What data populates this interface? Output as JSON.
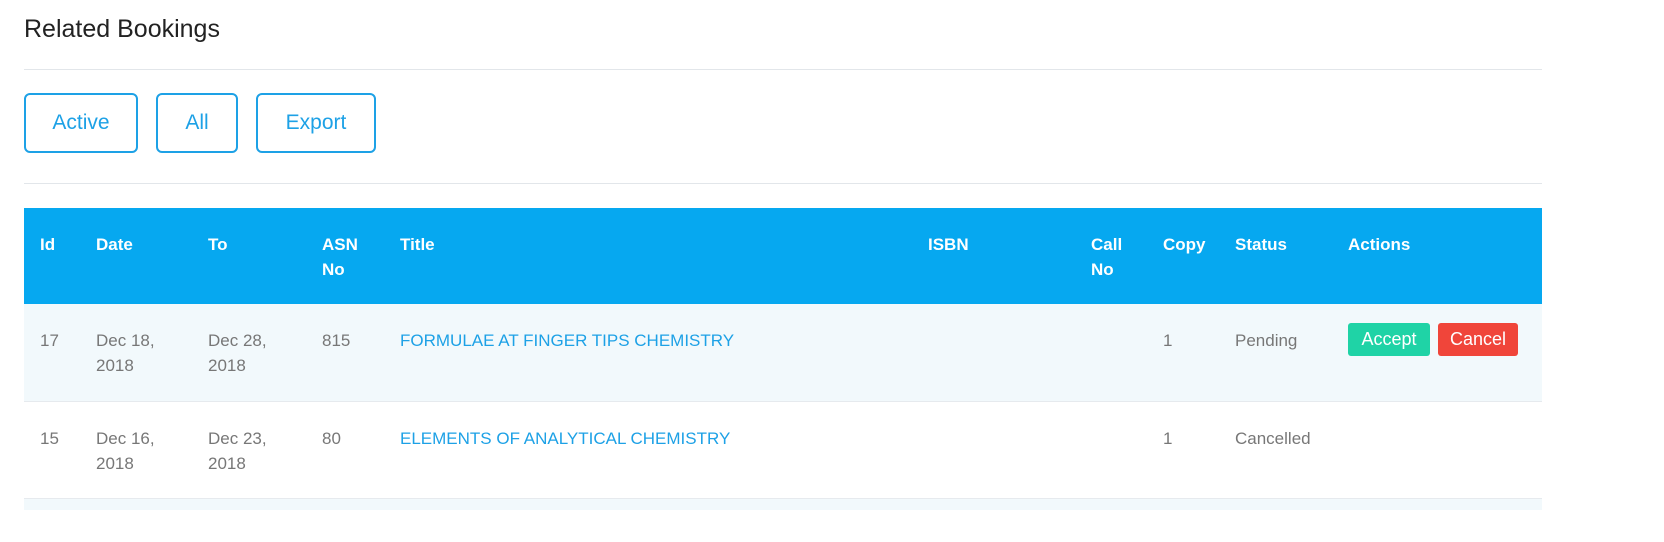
{
  "page": {
    "title": "Related Bookings"
  },
  "filters": {
    "active_label": "Active",
    "all_label": "All",
    "export_label": "Export"
  },
  "table": {
    "headers": {
      "id": "Id",
      "date": "Date",
      "to": "To",
      "asn_line1": "ASN",
      "asn_line2": "No",
      "title": "Title",
      "isbn": "ISBN",
      "call_line1": "Call",
      "call_line2": "No",
      "copy": "Copy",
      "status": "Status",
      "actions": "Actions"
    },
    "rows": [
      {
        "id": "17",
        "date_line1": "Dec 18,",
        "date_line2": "2018",
        "to_line1": "Dec 28,",
        "to_line2": "2018",
        "asn": "815",
        "title": "FORMULAE AT FINGER TIPS CHEMISTRY",
        "isbn": "",
        "call_no": "",
        "copy": "1",
        "status": "Pending",
        "accept_label": "Accept",
        "cancel_label": "Cancel"
      },
      {
        "id": "15",
        "date_line1": "Dec 16,",
        "date_line2": "2018",
        "to_line1": "Dec 23,",
        "to_line2": "2018",
        "asn": "80",
        "title": "ELEMENTS OF ANALYTICAL CHEMISTRY",
        "isbn": "",
        "call_no": "",
        "copy": "1",
        "status": "Cancelled"
      }
    ]
  },
  "colors": {
    "header_bg": "#06a8f0",
    "accent": "#1da1e6",
    "accept": "#1fd3a6",
    "cancel": "#f0453a",
    "row_alt": "#f2f9fc"
  }
}
